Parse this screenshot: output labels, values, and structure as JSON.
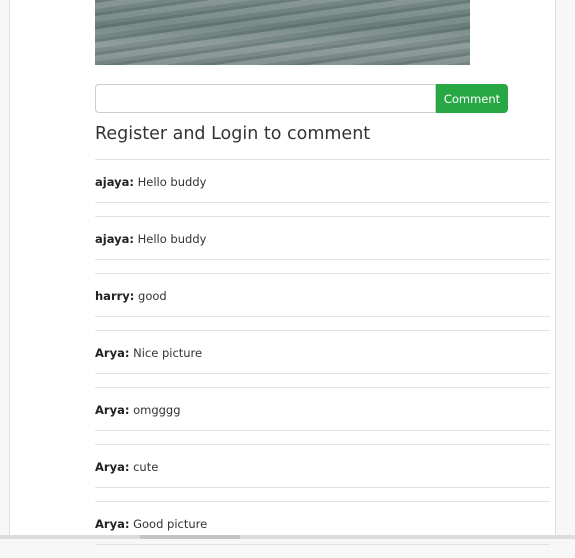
{
  "comment_form": {
    "input_value": "",
    "button_label": "Comment"
  },
  "login_prompt": "Register and Login to comment",
  "comments": [
    {
      "user": "ajaya:",
      "text": "Hello buddy"
    },
    {
      "user": "ajaya:",
      "text": "Hello buddy"
    },
    {
      "user": "harry:",
      "text": "good"
    },
    {
      "user": "Arya:",
      "text": "Nice picture"
    },
    {
      "user": "Arya:",
      "text": "omgggg"
    },
    {
      "user": "Arya:",
      "text": "cute"
    },
    {
      "user": "Arya:",
      "text": "Good picture"
    }
  ]
}
